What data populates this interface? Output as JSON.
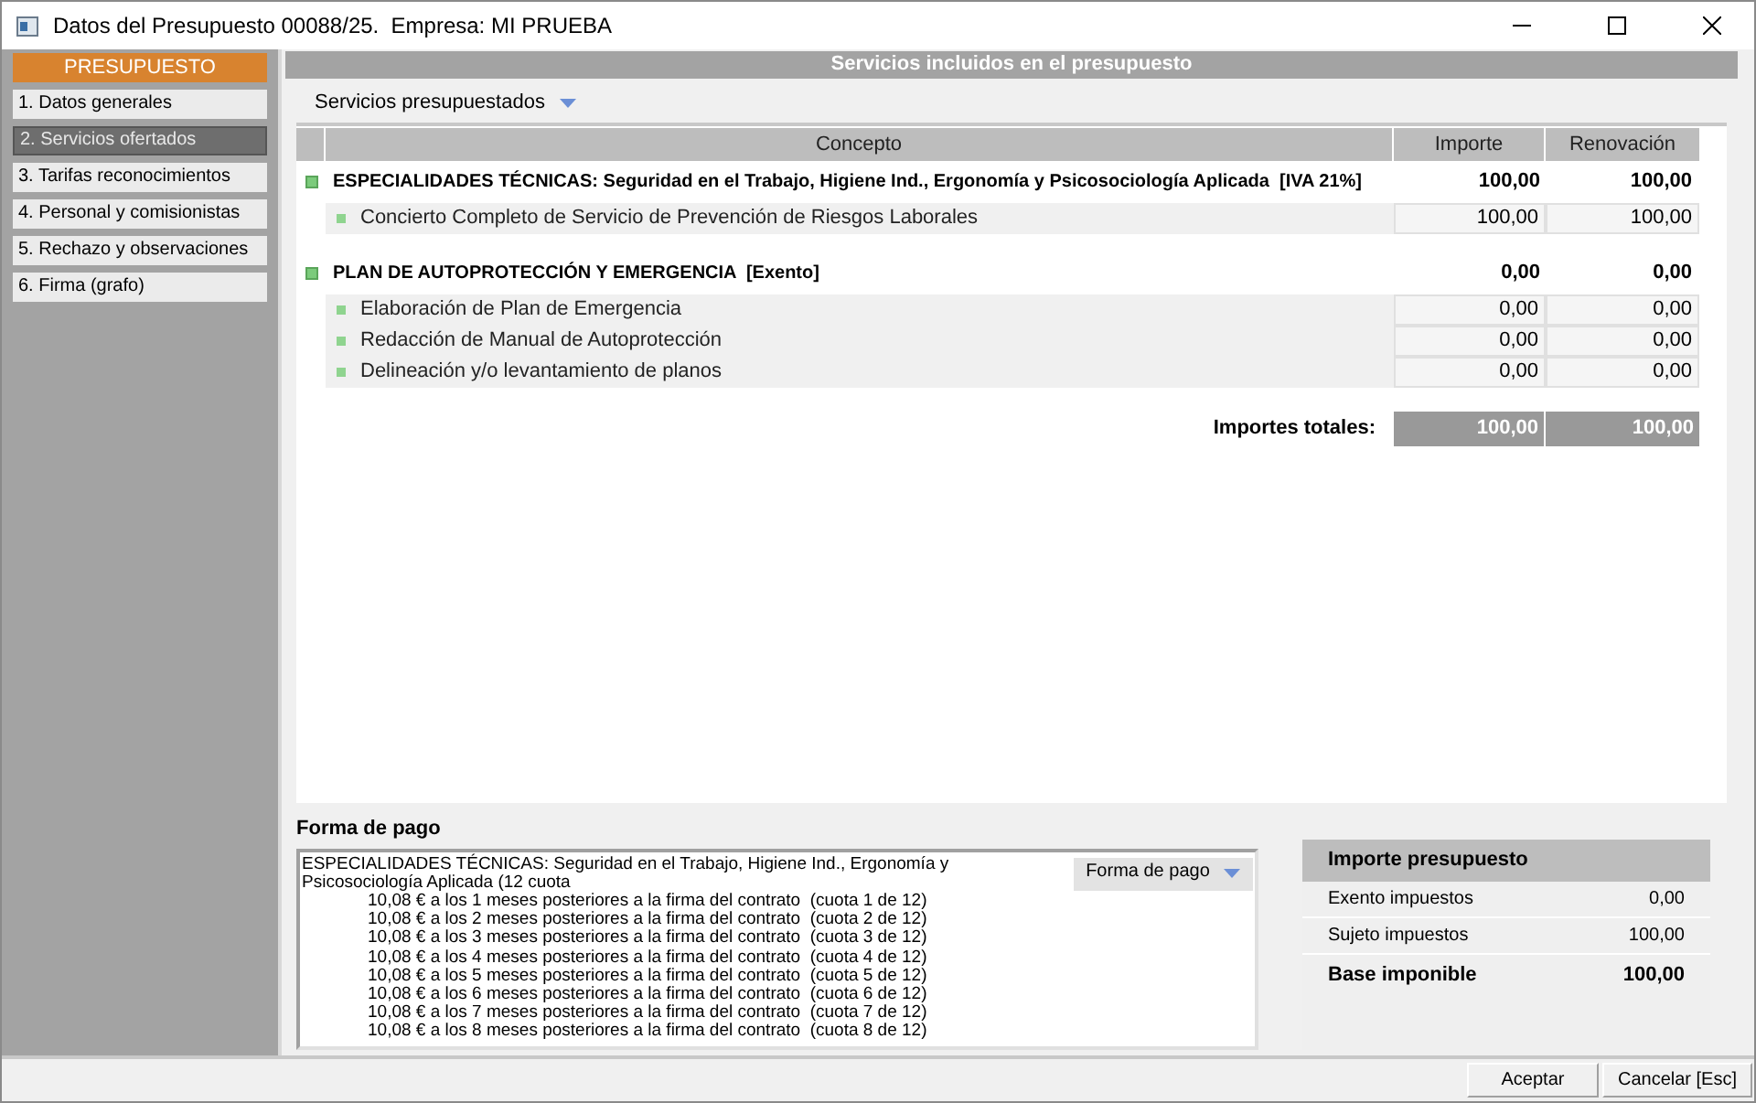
{
  "window": {
    "title": "Datos del Presupuesto 00088/25.  Empresa: MI PRUEBA"
  },
  "sidebar": {
    "header": "PRESUPUESTO",
    "items": [
      {
        "label": "1. Datos generales",
        "selected": false
      },
      {
        "label": "2. Servicios ofertados",
        "selected": true
      },
      {
        "label": "3. Tarifas reconocimientos",
        "selected": false
      },
      {
        "label": "4. Personal y comisionistas",
        "selected": false
      },
      {
        "label": "5. Rechazo y observaciones",
        "selected": false
      },
      {
        "label": "6. Firma (grafo)",
        "selected": false
      }
    ]
  },
  "main": {
    "header": "Servicios incluidos en el presupuesto",
    "dropdown": "Servicios presupuestados",
    "table": {
      "columns": [
        "Concepto",
        "Importe",
        "Renovación"
      ],
      "groups": [
        {
          "title": "ESPECIALIDADES TÉCNICAS: Seguridad en el Trabajo, Higiene Ind., Ergonomía y Psicosociología Aplicada  [IVA 21%]",
          "importe": "100,00",
          "renovacion": "100,00",
          "items": [
            {
              "concept": "Concierto Completo de Servicio de Prevención de Riesgos Laborales",
              "importe": "100,00",
              "renovacion": "100,00"
            }
          ]
        },
        {
          "title": "PLAN DE AUTOPROTECCIÓN Y EMERGENCIA  [Exento]",
          "importe": "0,00",
          "renovacion": "0,00",
          "items": [
            {
              "concept": "Elaboración de Plan de Emergencia",
              "importe": "0,00",
              "renovacion": "0,00"
            },
            {
              "concept": "Redacción de Manual de Autoprotección",
              "importe": "0,00",
              "renovacion": "0,00"
            },
            {
              "concept": "Delineación y/o levantamiento de planos",
              "importe": "0,00",
              "renovacion": "0,00"
            }
          ]
        }
      ],
      "totals": {
        "label": "Importes totales:",
        "importe": "100,00",
        "renovacion": "100,00"
      }
    }
  },
  "payment": {
    "label": "Forma de pago",
    "button": "Forma de pago",
    "lines": [
      {
        "kind": "heading",
        "text": "ESPECIALIDADES TÉCNICAS: Seguridad en el Trabajo, Higiene Ind., Ergonomía y Psicosociología Aplicada (12 cuota"
      },
      {
        "kind": "installment",
        "text": "10,08 € a los 1 meses posteriores a la firma del contrato  (cuota 1 de 12)"
      },
      {
        "kind": "installment",
        "text": "10,08 € a los 2 meses posteriores a la firma del contrato  (cuota 2 de 12)"
      },
      {
        "kind": "installment",
        "text": "10,08 € a los 3 meses posteriores a la firma del contrato  (cuota 3 de 12)"
      },
      {
        "kind": "installment",
        "text": "10,08 € a los 4 meses posteriores a la firma del contrato  (cuota 4 de 12)"
      },
      {
        "kind": "installment",
        "text": "10,08 € a los 5 meses posteriores a la firma del contrato  (cuota 5 de 12)"
      },
      {
        "kind": "installment",
        "text": "10,08 € a los 6 meses posteriores a la firma del contrato  (cuota 6 de 12)"
      },
      {
        "kind": "installment",
        "text": "10,08 € a los 7 meses posteriores a la firma del contrato  (cuota 7 de 12)"
      },
      {
        "kind": "installment",
        "text": "10,08 € a los 8 meses posteriores a la firma del contrato  (cuota 8 de 12)"
      }
    ]
  },
  "summary": {
    "title": "Importe presupuesto",
    "rows": [
      {
        "kind": "normal",
        "label": "Exento impuestos",
        "value": "0,00"
      },
      {
        "kind": "normal",
        "label": "Sujeto impuestos",
        "value": "100,00"
      },
      {
        "kind": "total",
        "label": "Base imponible",
        "value": "100,00"
      }
    ]
  },
  "buttons": [
    "Aceptar",
    "Cancelar [Esc]"
  ]
}
